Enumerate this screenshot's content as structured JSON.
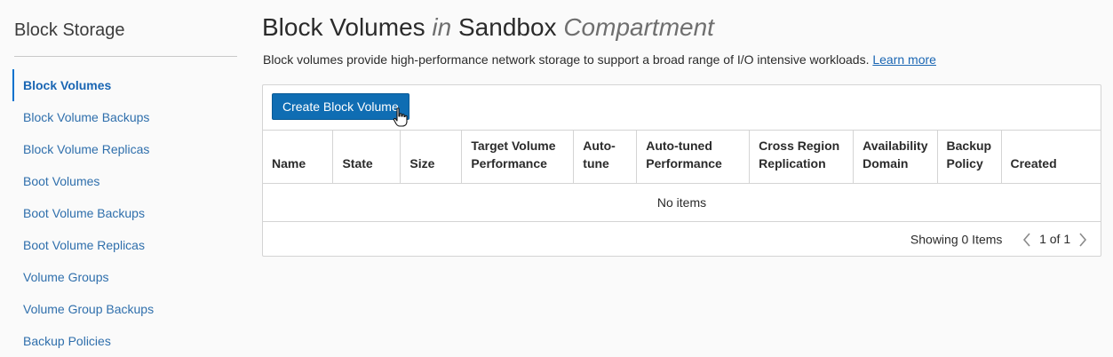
{
  "sidebar": {
    "title": "Block Storage",
    "items": [
      {
        "label": "Block Volumes",
        "active": true
      },
      {
        "label": "Block Volume Backups"
      },
      {
        "label": "Block Volume Replicas"
      },
      {
        "label": "Boot Volumes"
      },
      {
        "label": "Boot Volume Backups"
      },
      {
        "label": "Boot Volume Replicas"
      },
      {
        "label": "Volume Groups"
      },
      {
        "label": "Volume Group Backups"
      },
      {
        "label": "Backup Policies"
      }
    ]
  },
  "header": {
    "title": "Block Volumes",
    "in_word": "in",
    "compartment": "Sandbox",
    "compartment_suffix": "Compartment",
    "description": "Block volumes provide high-performance network storage to support a broad range of I/O intensive workloads.",
    "learn_more": "Learn more"
  },
  "toolbar": {
    "create_label": "Create Block Volume"
  },
  "table": {
    "columns": [
      [
        "Name"
      ],
      [
        "State"
      ],
      [
        "Size"
      ],
      [
        "Target Volume",
        "Performance"
      ],
      [
        "Auto-",
        "tune"
      ],
      [
        "Auto-tuned",
        "Performance"
      ],
      [
        "Cross Region",
        "Replication"
      ],
      [
        "Availability",
        "Domain"
      ],
      [
        "Backup",
        "Policy"
      ],
      [
        "Created"
      ]
    ],
    "empty_text": "No items"
  },
  "footer": {
    "showing": "Showing 0 Items",
    "page": "1 of 1"
  },
  "icons": {
    "prev": "chevron-left-icon",
    "next": "chevron-right-icon",
    "cursor": "hand-pointer-icon"
  },
  "colors": {
    "accent": "#0f6db3",
    "link": "#1a66b3"
  }
}
